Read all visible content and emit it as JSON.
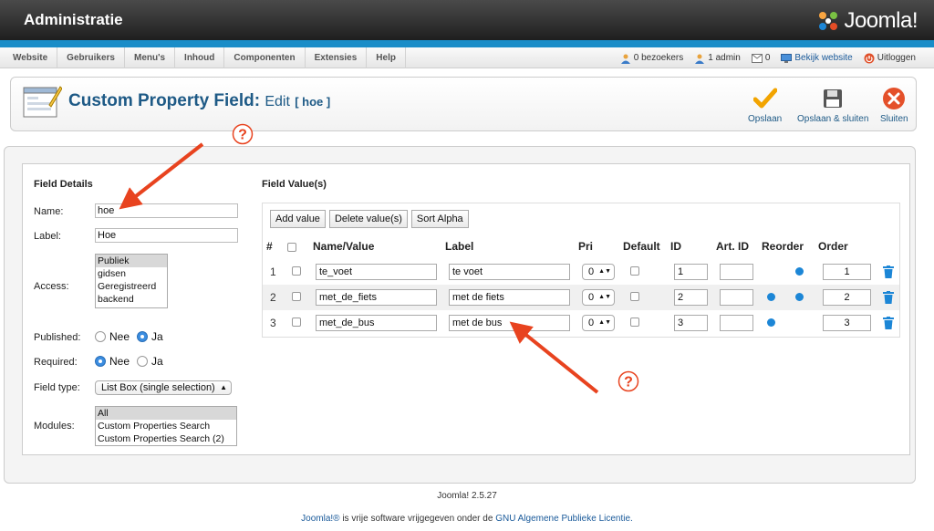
{
  "header": {
    "site_title": "Administratie",
    "logo_text": "Joomla!",
    "colors": {
      "bar": "#1a8dc8",
      "title": "#1e5a86"
    }
  },
  "menu": {
    "items": [
      "Website",
      "Gebruikers",
      "Menu's",
      "Inhoud",
      "Componenten",
      "Extensies",
      "Help"
    ]
  },
  "status": {
    "visitors": "0 bezoekers",
    "admins": "1 admin",
    "messages": "0",
    "view_site": "Bekijk website",
    "logout": "Uitloggen"
  },
  "toolbar": {
    "title_main": "Custom Property Field:",
    "title_edit": "Edit",
    "title_sub": "[ hoe ]",
    "save": "Opslaan",
    "save_close": "Opslaan & sluiten",
    "close": "Sluiten"
  },
  "field_details": {
    "heading": "Field Details",
    "name_label": "Name:",
    "name_value": "hoe",
    "label_label": "Label:",
    "label_value": "Hoe",
    "access_label": "Access:",
    "access_options": [
      "Publiek",
      "gidsen",
      "Geregistreerd",
      "backend"
    ],
    "access_selected": "Publiek",
    "published_label": "Published:",
    "required_label": "Required:",
    "no": "Nee",
    "yes": "Ja",
    "published_value": "Ja",
    "required_value": "Nee",
    "field_type_label": "Field type:",
    "field_type_value": "List Box (single selection)",
    "modules_label": "Modules:",
    "modules_options": [
      "All",
      "Custom Properties Search",
      "Custom Properties Search (2)"
    ],
    "modules_selected": "All"
  },
  "field_values": {
    "heading": "Field Value(s)",
    "buttons": {
      "add": "Add value",
      "delete": "Delete value(s)",
      "sort": "Sort Alpha"
    },
    "columns": {
      "num": "#",
      "name": "Name/Value",
      "label": "Label",
      "pri": "Pri",
      "default": "Default",
      "id": "ID",
      "art_id": "Art. ID",
      "reorder": "Reorder",
      "order": "Order"
    },
    "rows": [
      {
        "num": "1",
        "name": "te_voet",
        "label": "te voet",
        "pri": "0",
        "id": "1",
        "art_id": "",
        "order": "1"
      },
      {
        "num": "2",
        "name": "met_de_fiets",
        "label": "met de fiets",
        "pri": "0",
        "id": "2",
        "art_id": "",
        "order": "2"
      },
      {
        "num": "3",
        "name": "met_de_bus",
        "label": "met de bus",
        "pri": "0",
        "id": "3",
        "art_id": "",
        "order": "3"
      }
    ]
  },
  "footer": {
    "version": "Joomla! 2.5.27",
    "license_brand": "Joomla!®",
    "license_mid": " is vrije software vrijgegeven onder de ",
    "license_link": "GNU Algemene Publieke Licentie."
  },
  "annotations": {
    "marker": "?"
  }
}
